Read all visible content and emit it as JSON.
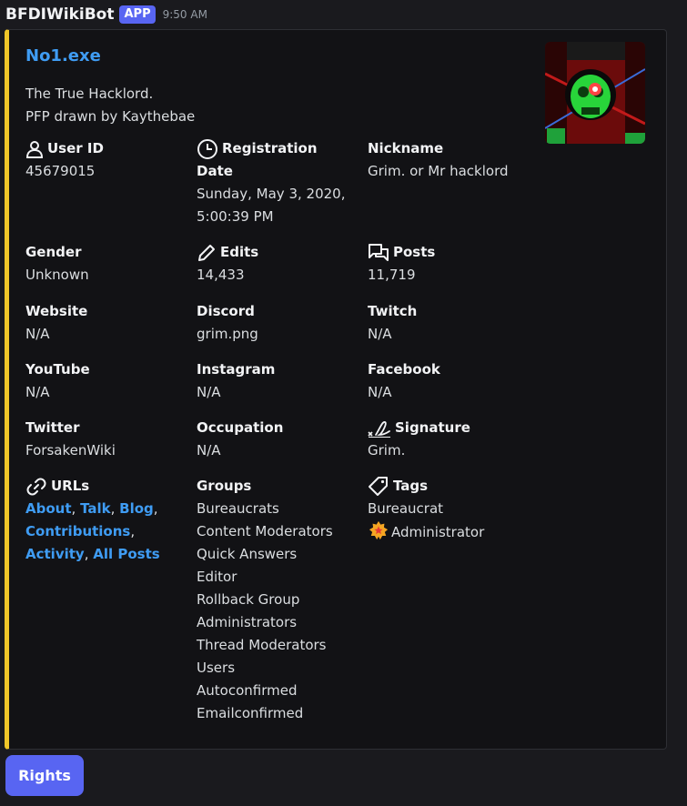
{
  "header": {
    "bot_name": "BFDIWikiBot",
    "app_badge": "APP",
    "timestamp": "9:50 AM"
  },
  "embed": {
    "accent_color": "#f0c629",
    "title": "No1.exe",
    "description": [
      "The True Hacklord.",
      "PFP drawn by Kaythebae"
    ],
    "thumbnail_icon": "skull-avatar-image"
  },
  "fields": {
    "user_id": {
      "name": "User ID",
      "value": "45679015",
      "icon": "user-icon"
    },
    "registration_date": {
      "name_line1": "Registration",
      "name_line2": "Date",
      "value": [
        "Sunday, May 3, 2020,",
        "5:00:39 PM"
      ],
      "icon": "clock-icon"
    },
    "nickname": {
      "name": "Nickname",
      "value": "Grim. or Mr hacklord"
    },
    "gender": {
      "name": "Gender",
      "value": "Unknown"
    },
    "edits": {
      "name": "Edits",
      "value": "14,433",
      "icon": "pencil-icon"
    },
    "posts": {
      "name": "Posts",
      "value": "11,719",
      "icon": "chat-bubbles-icon"
    },
    "website": {
      "name": "Website",
      "value": "N/A"
    },
    "discord": {
      "name": "Discord",
      "value": "grim.png"
    },
    "twitch": {
      "name": "Twitch",
      "value": "N/A"
    },
    "youtube": {
      "name": "YouTube",
      "value": "N/A"
    },
    "instagram": {
      "name": "Instagram",
      "value": "N/A"
    },
    "facebook": {
      "name": "Facebook",
      "value": "N/A"
    },
    "twitter": {
      "name": "Twitter",
      "value": "ForsakenWiki"
    },
    "occupation": {
      "name": "Occupation",
      "value": "N/A"
    },
    "signature": {
      "name": "Signature",
      "value": "Grim.",
      "icon": "signature-icon"
    },
    "urls": {
      "name": "URLs",
      "icon": "link-icon",
      "links": [
        "About",
        "Talk",
        "Blog",
        "Contributions",
        "Activity",
        "All Posts"
      ],
      "separator": ", "
    },
    "groups": {
      "name": "Groups",
      "values": [
        "Bureaucrats",
        "Content Moderators",
        "Quick Answers",
        "Editor",
        "Rollback Group",
        "Administrators",
        "Thread Moderators",
        "Users",
        "Autoconfirmed",
        "Emailconfirmed"
      ]
    },
    "tags": {
      "name": "Tags",
      "icon": "tag-icon",
      "values": [
        "Bureaucrat",
        "Administrator"
      ],
      "admin_badge_icon": "admin-star-badge-icon"
    }
  },
  "button": {
    "label": "Rights"
  },
  "colors": {
    "link": "#3f9cf3",
    "button": "#5865f2",
    "background": "#1a1a1e",
    "embed_background": "#121215"
  }
}
